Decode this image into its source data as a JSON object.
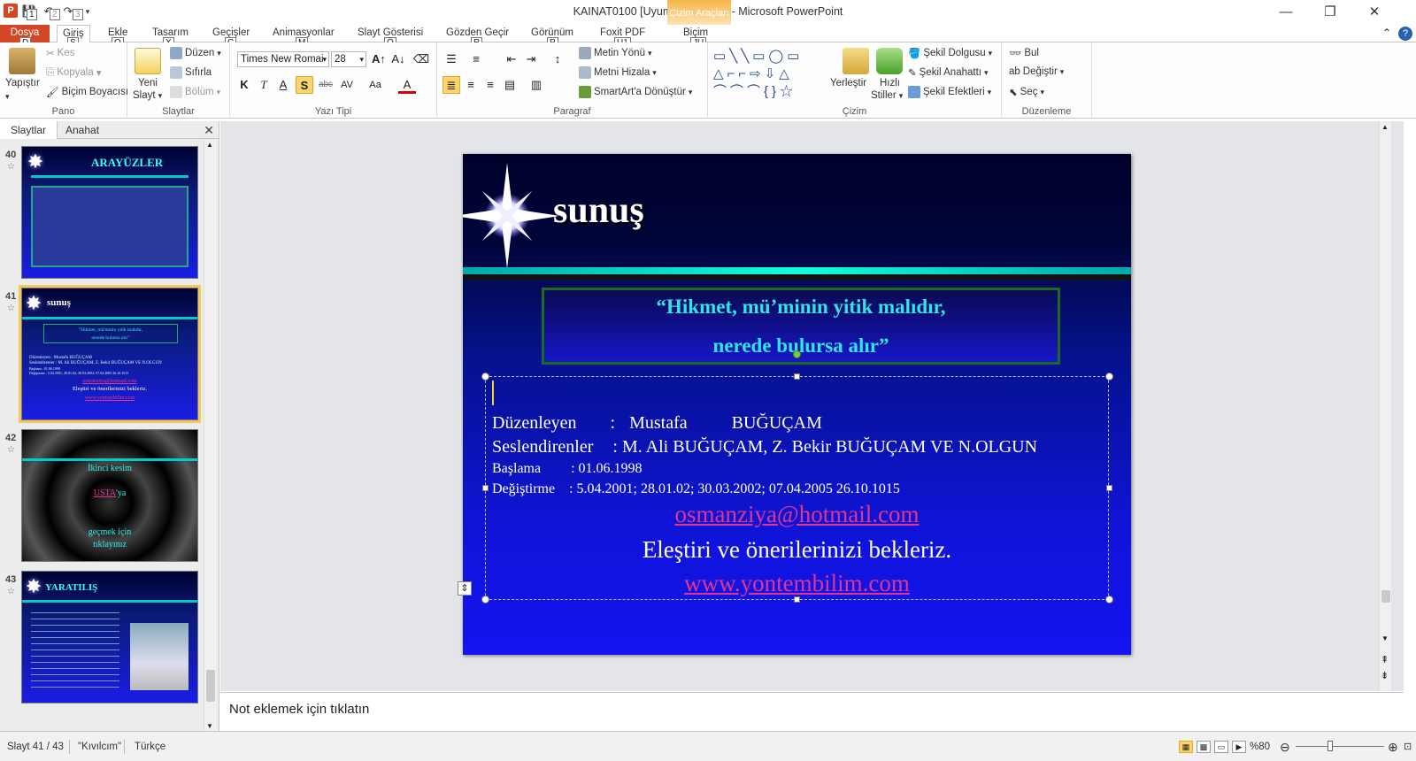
{
  "window": {
    "title": "KAINAT0100 [Uyumluluk Modu]  -  Microsoft PowerPoint",
    "app_icon_letter": "P",
    "qat_keytips": [
      "1",
      "2",
      "3"
    ],
    "context_tab_header": "Çizim Araçları",
    "controls": {
      "minimize": "—",
      "restore": "❐",
      "close": "✕"
    }
  },
  "ribbon_tabs": [
    {
      "label": "Dosya",
      "keytip": "D"
    },
    {
      "label": "Giriş",
      "keytip": "Ş"
    },
    {
      "label": "Ekle",
      "keytip": "O"
    },
    {
      "label": "Tasarım",
      "keytip": "X"
    },
    {
      "label": "Geçişler",
      "keytip": "Ç"
    },
    {
      "label": "Animasyonlar",
      "keytip": "M"
    },
    {
      "label": "Slayt Gösterisi",
      "keytip": "Ö"
    },
    {
      "label": "Gözden Geçir",
      "keytip": "R"
    },
    {
      "label": "Görünüm",
      "keytip": "P"
    },
    {
      "label": "Foxit PDF",
      "keytip": "U1"
    },
    {
      "label": "Biçim",
      "keytip": "JU"
    }
  ],
  "ribbon_right": {
    "collapse": "⌃",
    "help": "?"
  },
  "groups": {
    "pano": {
      "label": "Pano",
      "paste": "Yapıştır",
      "cut": "Kes",
      "copy": "Kopyala",
      "format_painter": "Biçim Boyacısı"
    },
    "slaytlar": {
      "label": "Slaytlar",
      "new_slide_1": "Yeni",
      "new_slide_2": "Slayt",
      "layout": "Düzen",
      "reset": "Sıfırla",
      "section": "Bölüm"
    },
    "yazi_tipi": {
      "label": "Yazı Tipi",
      "font_name": "Times New Romai",
      "font_size": "28",
      "bold": "K",
      "italic": "T",
      "underline": "A",
      "shadow": "S",
      "strike": "abc",
      "spacing": "AV",
      "case": "Aa",
      "color": "A"
    },
    "paragraf": {
      "label": "Paragraf",
      "text_direction": "Metin Yönü",
      "align_text": "Metni Hizala",
      "smartart": "SmartArt'a Dönüştür"
    },
    "cizim": {
      "label": "Çizim",
      "arrange": "Yerleştir",
      "quick_styles_1": "Hızlı",
      "quick_styles_2": "Stiller",
      "shape_fill": "Şekil Dolgusu",
      "shape_outline": "Şekil Anahattı",
      "shape_effects": "Şekil Efektleri"
    },
    "duzenleme": {
      "label": "Düzenleme",
      "find": "Bul",
      "replace": "Değiştir",
      "select": "Seç"
    }
  },
  "left_panel": {
    "tabs": [
      "Slaytlar",
      "Anahat"
    ],
    "close": "✕",
    "thumbnails": [
      {
        "num": "40",
        "title": "ARAYÜZLER"
      },
      {
        "num": "41",
        "title": "sunuş",
        "selected": true,
        "quote_1": "\"Hikmet, mü'minin yitik malıdır,",
        "quote_2": "nerede bulursa alır\"",
        "lines": [
          "Düzenleyen  : Mustafa  BUĞUÇAM",
          "Seslendirenler : M. Ali BUĞUÇAM, Z. Bekir BUĞUÇAM VE N.OLGUN",
          "Başlama  : 01.06.1998",
          "Değiştirme : 5.04.2001; 28.01.02; 30.03.2002; 07.04.2005 26.10.1015"
        ],
        "email": "osmanziya@hotmail.com",
        "feedback": "Eleştiri ve önerilerinizi bekleriz.",
        "web": "www.yontembilim.com"
      },
      {
        "num": "42",
        "line1": "İkinci kesim",
        "usta": "USTA",
        "usta_suffix": "'ya",
        "line3": "geçmek  için",
        "line4": "tıklayınız"
      },
      {
        "num": "43",
        "title": "YARATILIŞ"
      }
    ]
  },
  "slide": {
    "title": "sunuş",
    "quote_1": "“Hikmet, mü’minin yitik malıdır,",
    "quote_2": "nerede bulursa alır”",
    "editor_label": "Düzenleyen",
    "editor_sep": ":",
    "editor_first": "Mustafa",
    "editor_last": "BUĞUÇAM",
    "voices_label": "Seslendirenler",
    "voices_value": ":  M. Ali BUĞUÇAM,  Z. Bekir BUĞUÇAM  VE  N.OLGUN",
    "start_label": "Başlama",
    "start_value": ": 01.06.1998",
    "change_label": "Değiştirme",
    "change_value": ": 5.04.2001; 28.01.02; 30.03.2002;  07.04.2005 26.10.1015",
    "email": "osmanziya@hotmail.com",
    "feedback": "Eleştiri  ve  önerilerinizi  bekleriz.",
    "web": "www.yontembilim.com"
  },
  "notes": {
    "placeholder": "Not eklemek için tıklatın"
  },
  "status": {
    "slide_info": "Slayt 41 / 43",
    "theme": "\"Kıvılcım\"",
    "language": "Türkçe",
    "zoom": "%80",
    "zoom_level_percent": 80
  }
}
